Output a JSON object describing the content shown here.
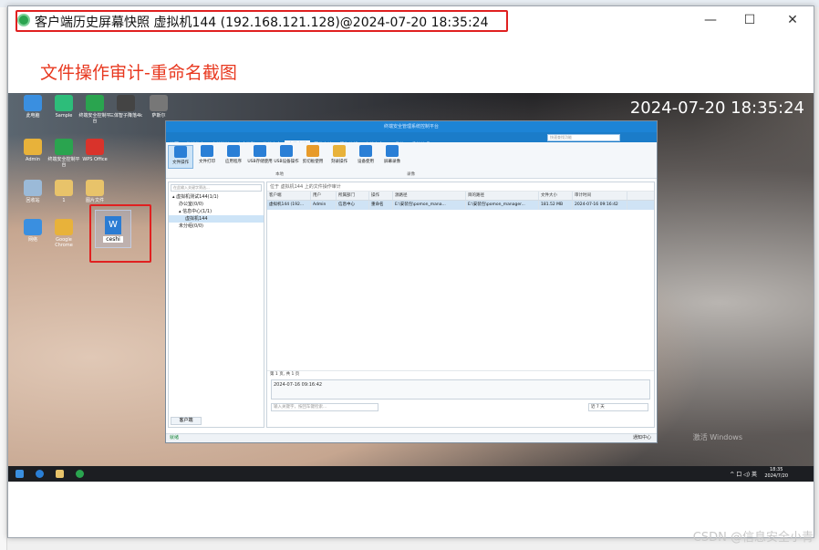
{
  "outer_window": {
    "title": "客户端历史屏幕快照 虚拟机144 (192.168.121.128)@2024-07-20 18:35:24",
    "minimize": "—",
    "maximize": "☐",
    "close": "✕",
    "caption": "文件操作审计-重命名截图"
  },
  "desktop": {
    "datetime": "2024-07-20 18:35:24",
    "icons": [
      {
        "label": "此电脑",
        "color": "#3a8fe0"
      },
      {
        "label": "Sample",
        "color": "#2dbd7a"
      },
      {
        "label": "终端安全控制平台",
        "color": "#2aa44f"
      },
      {
        "label": "三体智子降落4k",
        "color": "#444"
      },
      {
        "label": "萨斯尔",
        "color": "#777"
      },
      {
        "label": "Admin",
        "color": "#e8b23a"
      },
      {
        "label": "终端安全控制平台",
        "color": "#2aa44f"
      },
      {
        "label": "WPS Office",
        "color": "#d9332b"
      },
      {
        "label": "回收站",
        "color": "#9bbad8"
      },
      {
        "label": "1",
        "color": "#e8c36a"
      },
      {
        "label": "图片文件",
        "color": "#e8c36a"
      },
      {
        "label": "网络",
        "color": "#3a8fe0"
      },
      {
        "label": "Google Chrome",
        "color": "#e8b23a"
      }
    ],
    "selected_file": {
      "label": "ceshi",
      "glyph": "W"
    },
    "activation_text": "激活 Windows",
    "taskbar": {
      "tray": "^ 口 ◁) 英",
      "time": "18:35",
      "date": "2024/7/20"
    }
  },
  "app": {
    "title": "终端安全管理系统控制平台",
    "menu": [
      "首页",
      "终端信息",
      "文档监控",
      "安全策略",
      "终端安全",
      "本地审计",
      "网络审计",
      "行为分析",
      "文档安全",
      "工具箱",
      "系统管理"
    ],
    "active_menu": "本地审计",
    "search_placeholder": "快速查找功能",
    "toolbar": [
      "文件操作",
      "文件打印",
      "应用程序",
      "USB存储使用",
      "USB设备操作",
      "剪切板使用",
      "刻录操作",
      "设备使用",
      "屏幕录像"
    ],
    "toolbar_groups": [
      "本地",
      "录像"
    ],
    "tree_search_placeholder": "在此输入关键字筛选...",
    "tree": [
      {
        "label": "▴ 虚拟机测试144(1/1)",
        "indent": 0
      },
      {
        "label": "办公室(0/0)",
        "indent": 1
      },
      {
        "label": "▴ 信息中心(1/1)",
        "indent": 1
      },
      {
        "label": "虚拟机144",
        "indent": 2,
        "selected": true
      },
      {
        "label": "未分组(0/0)",
        "indent": 1
      }
    ],
    "tree_tab": "客户端",
    "main_header": "位于 虚拟机144 上的文件操作审计",
    "columns": [
      "客户端",
      "用户",
      "所属部门",
      "操作",
      "源路径",
      "目的路径",
      "文件大小",
      "审计时间"
    ],
    "rows": [
      [
        "虚拟机144 (192...",
        "Admin",
        "信息中心",
        "重命名",
        "E:\\安装包\\pomon_mana...",
        "E:\\安装包\\pomon_manager...",
        "181.52 MB",
        "2024-07-16 09:16:42"
      ]
    ],
    "pager": "第 1 页, 共 1 页",
    "detail_time": "2024-07-16 09:16:42",
    "keyword_placeholder": "输入关键字，按回车键检索...",
    "range": "近 7 天",
    "status_left": "就绪",
    "status_right": "通知中心"
  },
  "watermark": "CSDN @信息安全小青"
}
